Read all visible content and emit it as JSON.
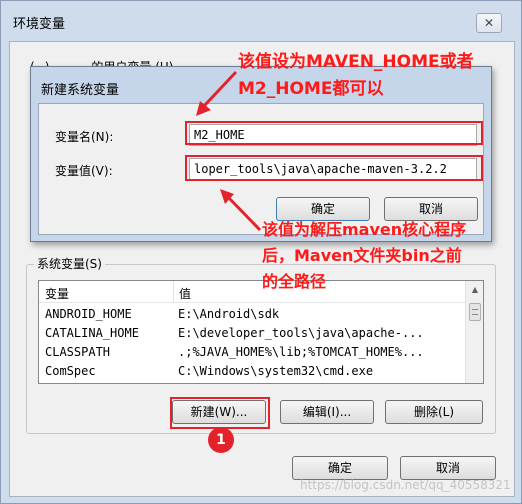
{
  "outer_window": {
    "title": "环境变量",
    "close_glyph": "✕",
    "user_group_label": "(~) . . . . . 的用户变量 (U)",
    "system_group_label": "系统变量(S)",
    "system_table": {
      "columns": [
        "变量",
        "值"
      ],
      "rows": [
        {
          "name": "ANDROID_HOME",
          "value": "E:\\Android\\sdk"
        },
        {
          "name": "CATALINA_HOME",
          "value": "E:\\developer_tools\\java\\apache-..."
        },
        {
          "name": "CLASSPATH",
          "value": ".;%JAVA_HOME%\\lib;%TOMCAT_HOME%..."
        },
        {
          "name": "ComSpec",
          "value": "C:\\Windows\\system32\\cmd.exe"
        }
      ]
    },
    "buttons": {
      "new": "新建(W)...",
      "edit": "编辑(I)...",
      "delete": "删除(L)",
      "ok": "确定",
      "cancel": "取消"
    }
  },
  "dialog": {
    "title": "新建系统变量",
    "name_label": "变量名(N):",
    "name_value": "M2_HOME",
    "value_label": "变量值(V):",
    "value_value": "loper_tools\\java\\apache-maven-3.2.2",
    "ok": "确定",
    "cancel": "取消"
  },
  "annotations": {
    "note1_line1": "该值设为MAVEN_HOME或者",
    "note1_line2": "M2_HOME都可以",
    "note2_line1": "该值为解压maven核心程序",
    "note2_line2": "后，Maven文件夹bin之前",
    "note2_line3": "的全路径",
    "badge": "1",
    "color": "#ff1a1a"
  },
  "watermark": "https://blog.csdn.net/qq_40558321"
}
